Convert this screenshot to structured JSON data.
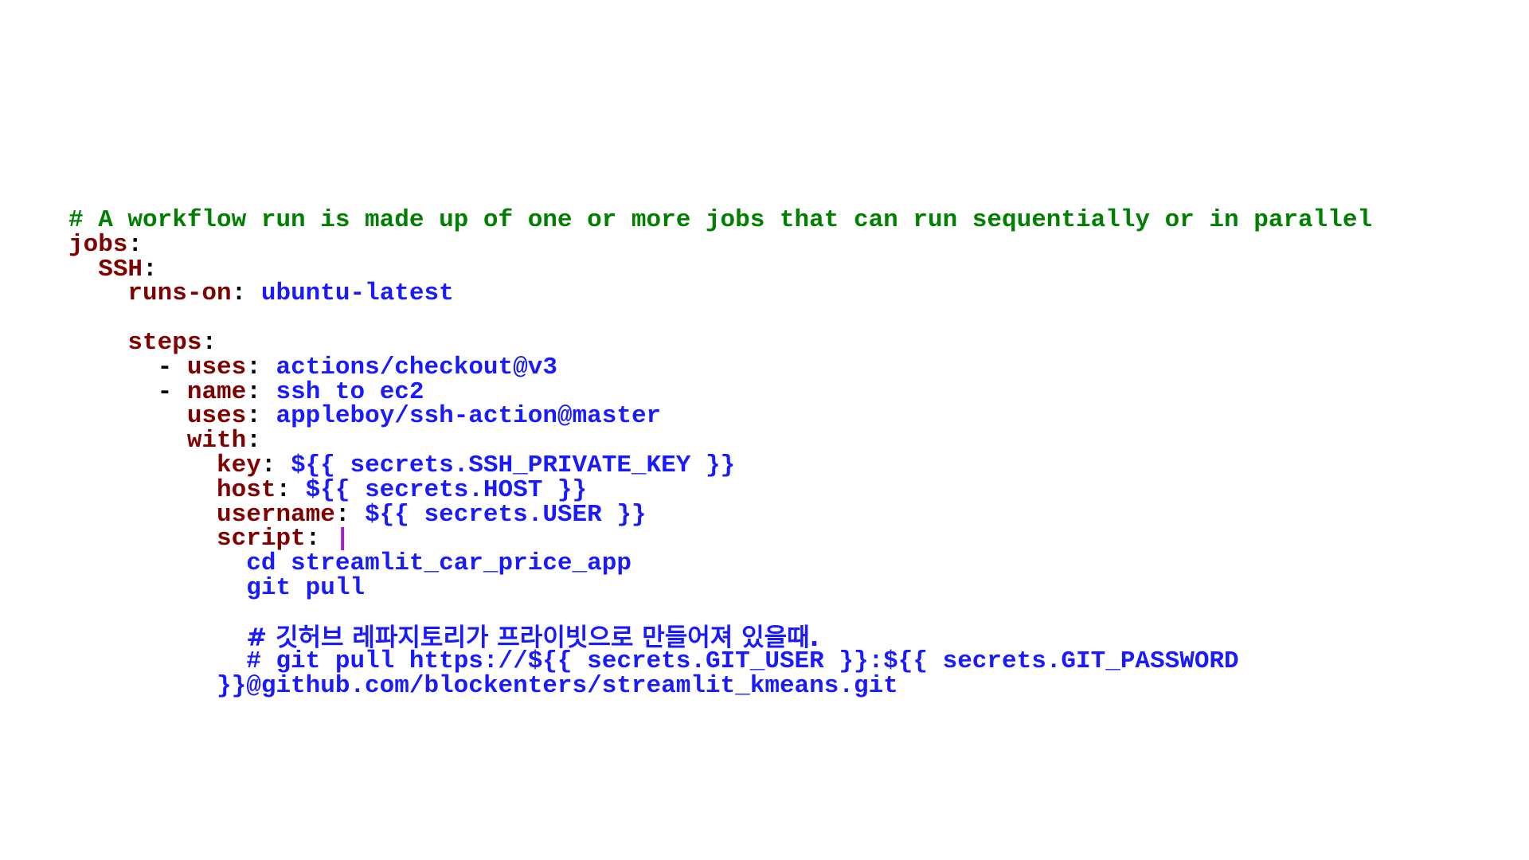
{
  "code": {
    "line1_comment": "# A workflow run is made up of one or more jobs that can run sequentially or in parallel",
    "jobs_key": "jobs",
    "ssh_key": "SSH",
    "runs_on_key": "runs-on",
    "runs_on_value": "ubuntu-latest",
    "steps_key": "steps",
    "dash": "-",
    "uses_key": "uses",
    "uses_checkout_value": "actions/checkout@v3",
    "name_key": "name",
    "name_value": "ssh to ec2",
    "uses_ssh_value": "appleboy/ssh-action@master",
    "with_key": "with",
    "key_key": "key",
    "key_value": "${{ secrets.SSH_PRIVATE_KEY }}",
    "host_key": "host",
    "host_value": "${{ secrets.HOST }}",
    "username_key": "username",
    "username_value": "${{ secrets.USER }}",
    "script_key": "script",
    "script_pipe": "|",
    "script_line1": "cd streamlit_car_price_app",
    "script_line2": "git pull",
    "korean_comment": "# 깃허브 레파지토리가 프라이빗으로 만들어져 있을때.",
    "git_comment_line1": "# git pull https://${{ secrets.GIT_USER }}:${{ secrets.GIT_PASSWORD",
    "git_comment_line2": "}}@github.com/blockenters/streamlit_kmeans.git"
  }
}
